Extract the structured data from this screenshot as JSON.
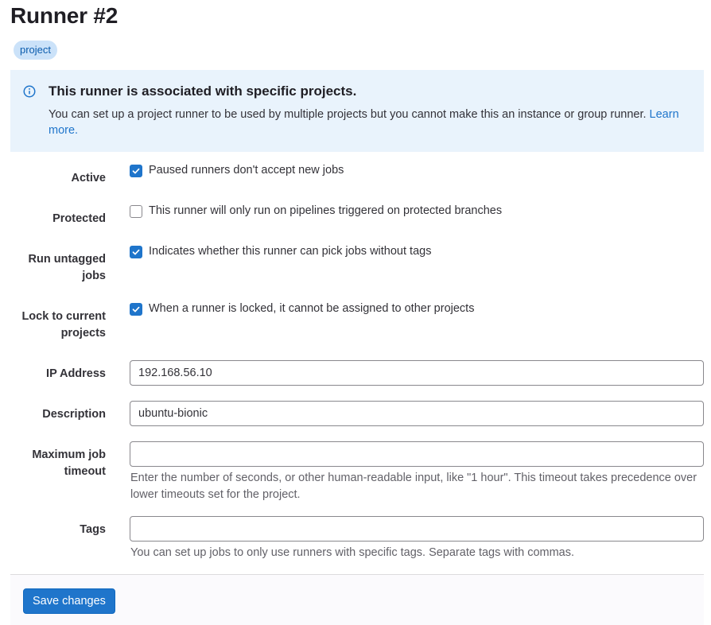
{
  "page": {
    "title": "Runner #2",
    "badge": "project"
  },
  "alert": {
    "icon": "info-icon",
    "title": "This runner is associated with specific projects.",
    "body": "You can set up a project runner to be used by multiple projects but you cannot make this an instance or group runner.",
    "link": "Learn more."
  },
  "form": {
    "active": {
      "label": "Active",
      "checked": true,
      "text": "Paused runners don't accept new jobs"
    },
    "protected": {
      "label": "Protected",
      "checked": false,
      "text": "This runner will only run on pipelines triggered on protected branches"
    },
    "run_untagged": {
      "label_line1": "Run untagged",
      "label_line2": "jobs",
      "checked": true,
      "text": "Indicates whether this runner can pick jobs without tags"
    },
    "locked": {
      "label_line1": "Lock to current",
      "label_line2": "projects",
      "checked": true,
      "text": "When a runner is locked, it cannot be assigned to other projects"
    },
    "ip_address": {
      "label": "IP Address",
      "value": "192.168.56.10"
    },
    "description": {
      "label": "Description",
      "value": "ubuntu-bionic"
    },
    "max_timeout": {
      "label_line1": "Maximum job",
      "label_line2": "timeout",
      "value": "",
      "help": "Enter the number of seconds, or other human-readable input, like \"1 hour\". This timeout takes precedence over lower timeouts set for the project."
    },
    "tags": {
      "label": "Tags",
      "value": "",
      "help": "You can set up jobs to only use runners with specific tags. Separate tags with commas."
    }
  },
  "footer": {
    "save_label": "Save changes"
  },
  "colors": {
    "primary": "#1f75cb",
    "alert_bg": "#e9f3fc",
    "badge_bg": "#cbe2f9"
  }
}
